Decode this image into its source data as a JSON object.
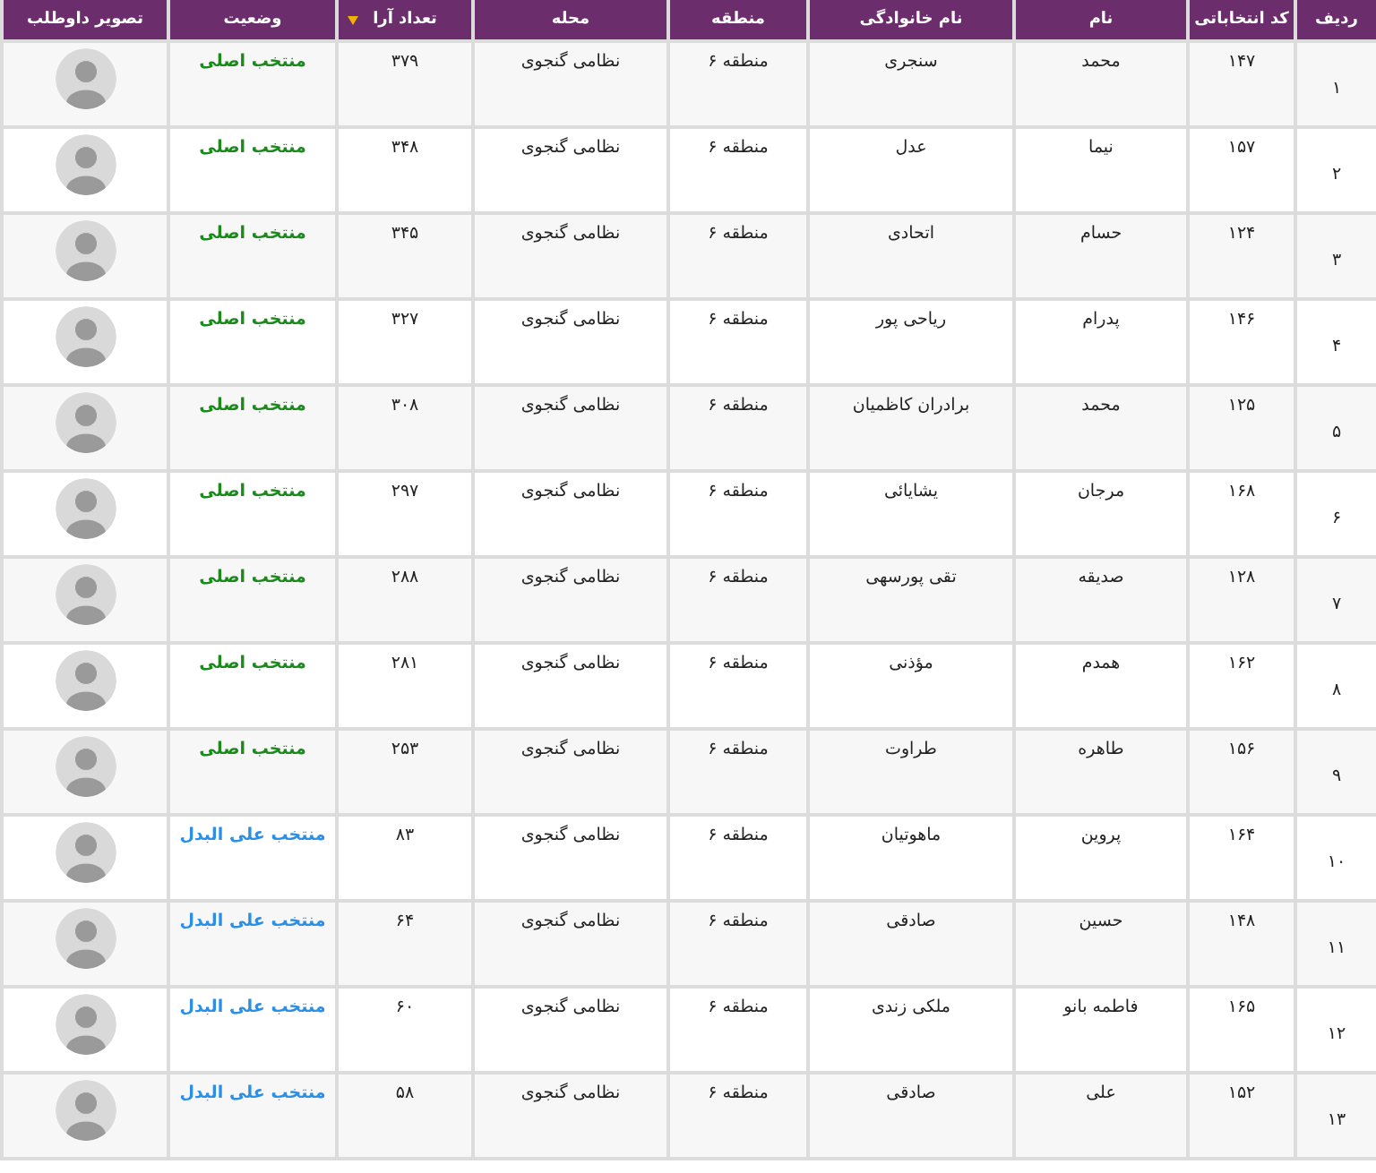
{
  "table": {
    "columns": [
      {
        "label": "ردیف",
        "sorted": false
      },
      {
        "label": "کد انتخاباتی",
        "sorted": false
      },
      {
        "label": "نام",
        "sorted": false
      },
      {
        "label": "نام خانوادگی",
        "sorted": false
      },
      {
        "label": "منطقه",
        "sorted": false
      },
      {
        "label": "محله",
        "sorted": false
      },
      {
        "label": "تعداد آرا",
        "sorted": true
      },
      {
        "label": "وضعیت",
        "sorted": false
      },
      {
        "label": "تصویر داوطلب",
        "sorted": false
      }
    ],
    "rows": [
      {
        "index": "۱",
        "code": "۱۴۷",
        "first_name": "محمد",
        "last_name": "سنجری",
        "region": "منطقه ۶",
        "neighborhood": "نظامی گنجوی",
        "votes": "۳۷۹",
        "status": {
          "text": "منتخب اصلی",
          "kind": "main"
        }
      },
      {
        "index": "۲",
        "code": "۱۵۷",
        "first_name": "نیما",
        "last_name": "عدل",
        "region": "منطقه ۶",
        "neighborhood": "نظامی گنجوی",
        "votes": "۳۴۸",
        "status": {
          "text": "منتخب اصلی",
          "kind": "main"
        }
      },
      {
        "index": "۳",
        "code": "۱۲۴",
        "first_name": "حسام",
        "last_name": "اتحادی",
        "region": "منطقه ۶",
        "neighborhood": "نظامی گنجوی",
        "votes": "۳۴۵",
        "status": {
          "text": "منتخب اصلی",
          "kind": "main"
        }
      },
      {
        "index": "۴",
        "code": "۱۴۶",
        "first_name": "پدرام",
        "last_name": "ریاحی پور",
        "region": "منطقه ۶",
        "neighborhood": "نظامی گنجوی",
        "votes": "۳۲۷",
        "status": {
          "text": "منتخب اصلی",
          "kind": "main"
        }
      },
      {
        "index": "۵",
        "code": "۱۲۵",
        "first_name": "محمد",
        "last_name": "برادران کاظمیان",
        "region": "منطقه ۶",
        "neighborhood": "نظامی گنجوی",
        "votes": "۳۰۸",
        "status": {
          "text": "منتخب اصلی",
          "kind": "main"
        }
      },
      {
        "index": "۶",
        "code": "۱۶۸",
        "first_name": "مرجان",
        "last_name": "یشایائی",
        "region": "منطقه ۶",
        "neighborhood": "نظامی گنجوی",
        "votes": "۲۹۷",
        "status": {
          "text": "منتخب اصلی",
          "kind": "main"
        }
      },
      {
        "index": "۷",
        "code": "۱۲۸",
        "first_name": "صدیقه",
        "last_name": "تقی پورسهی",
        "region": "منطقه ۶",
        "neighborhood": "نظامی گنجوی",
        "votes": "۲۸۸",
        "status": {
          "text": "منتخب اصلی",
          "kind": "main"
        }
      },
      {
        "index": "۸",
        "code": "۱۶۲",
        "first_name": "همدم",
        "last_name": "مؤذنی",
        "region": "منطقه ۶",
        "neighborhood": "نظامی گنجوی",
        "votes": "۲۸۱",
        "status": {
          "text": "منتخب اصلی",
          "kind": "main"
        }
      },
      {
        "index": "۹",
        "code": "۱۵۶",
        "first_name": "طاهره",
        "last_name": "طراوت",
        "region": "منطقه ۶",
        "neighborhood": "نظامی گنجوی",
        "votes": "۲۵۳",
        "status": {
          "text": "منتخب اصلی",
          "kind": "main"
        }
      },
      {
        "index": "۱۰",
        "code": "۱۶۴",
        "first_name": "پروین",
        "last_name": "ماهوتیان",
        "region": "منطقه ۶",
        "neighborhood": "نظامی گنجوی",
        "votes": "۸۳",
        "status": {
          "text": "منتخب علی البدل",
          "kind": "alternate"
        }
      },
      {
        "index": "۱۱",
        "code": "۱۴۸",
        "first_name": "حسین",
        "last_name": "صادقی",
        "region": "منطقه ۶",
        "neighborhood": "نظامی گنجوی",
        "votes": "۶۴",
        "status": {
          "text": "منتخب علی البدل",
          "kind": "alternate"
        }
      },
      {
        "index": "۱۲",
        "code": "۱۶۵",
        "first_name": "فاطمه بانو",
        "last_name": "ملکی زندی",
        "region": "منطقه ۶",
        "neighborhood": "نظامی گنجوی",
        "votes": "۶۰",
        "status": {
          "text": "منتخب علی البدل",
          "kind": "alternate"
        }
      },
      {
        "index": "۱۳",
        "code": "۱۵۲",
        "first_name": "علی",
        "last_name": "صادقی",
        "region": "منطقه ۶",
        "neighborhood": "نظامی گنجوی",
        "votes": "۵۸",
        "status": {
          "text": "منتخب علی البدل",
          "kind": "alternate"
        }
      }
    ]
  }
}
